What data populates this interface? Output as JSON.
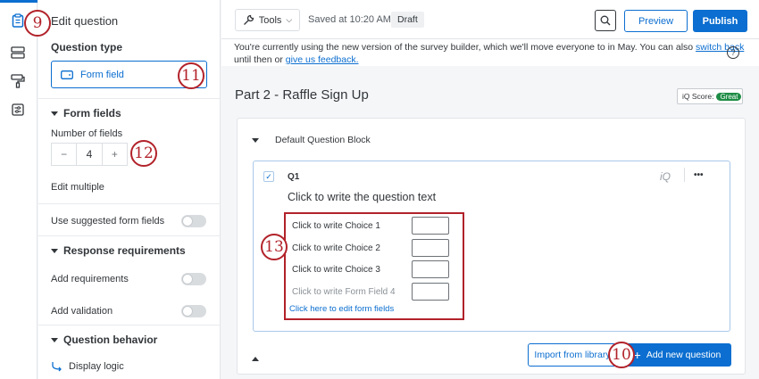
{
  "rail": {
    "icons": [
      "clipboard-icon",
      "layout-icon",
      "paint-roller-icon",
      "sliders-icon"
    ]
  },
  "panel": {
    "title": "Edit question",
    "question_type_heading": "Question type",
    "question_type_value": "Form field",
    "form_fields_heading": "Form fields",
    "number_of_fields_label": "Number of fields",
    "stepper": {
      "minus": "−",
      "value": "4",
      "plus": "+"
    },
    "edit_multiple": "Edit multiple",
    "use_suggested_label": "Use suggested form fields",
    "response_req_heading": "Response requirements",
    "add_requirements_label": "Add requirements",
    "add_validation_label": "Add validation",
    "question_behavior_heading": "Question behavior",
    "display_logic": "Display logic"
  },
  "toolbar": {
    "tools_label": "Tools",
    "saved_status": "Saved at 10:20 AM",
    "draft_badge": "Draft",
    "preview_label": "Preview",
    "publish_label": "Publish"
  },
  "banner": {
    "text_1": "You're currently using the new version of the survey builder, which we'll move everyone to in May. You can also ",
    "link_switch": "switch back",
    "text_2": "until then or ",
    "link_feedback": "give us feedback."
  },
  "survey": {
    "block_title": "Part 2 - Raffle Sign Up",
    "iq_score_label": "iQ Score:",
    "iq_score_value": "Great",
    "default_block_label": "Default Question Block",
    "question_id": "Q1",
    "question_text": "Click to write the question text",
    "iq_icon_text": "iQ",
    "more_icon_text": "•••",
    "choices": [
      "Click to write Choice 1",
      "Click to write Choice 2",
      "Click to write Choice 3",
      "Click to write Form Field 4"
    ],
    "edit_form_fields_link": "Click here to edit form fields",
    "import_label": "Import from library",
    "add_question_label": "Add new question"
  },
  "annotations": {
    "n9": "9",
    "n10": "10",
    "n11": "11",
    "n12": "12",
    "n13": "13"
  },
  "colors": {
    "accent": "#0b6ed0",
    "annotation": "#b2222a",
    "great": "#1e8c45"
  }
}
